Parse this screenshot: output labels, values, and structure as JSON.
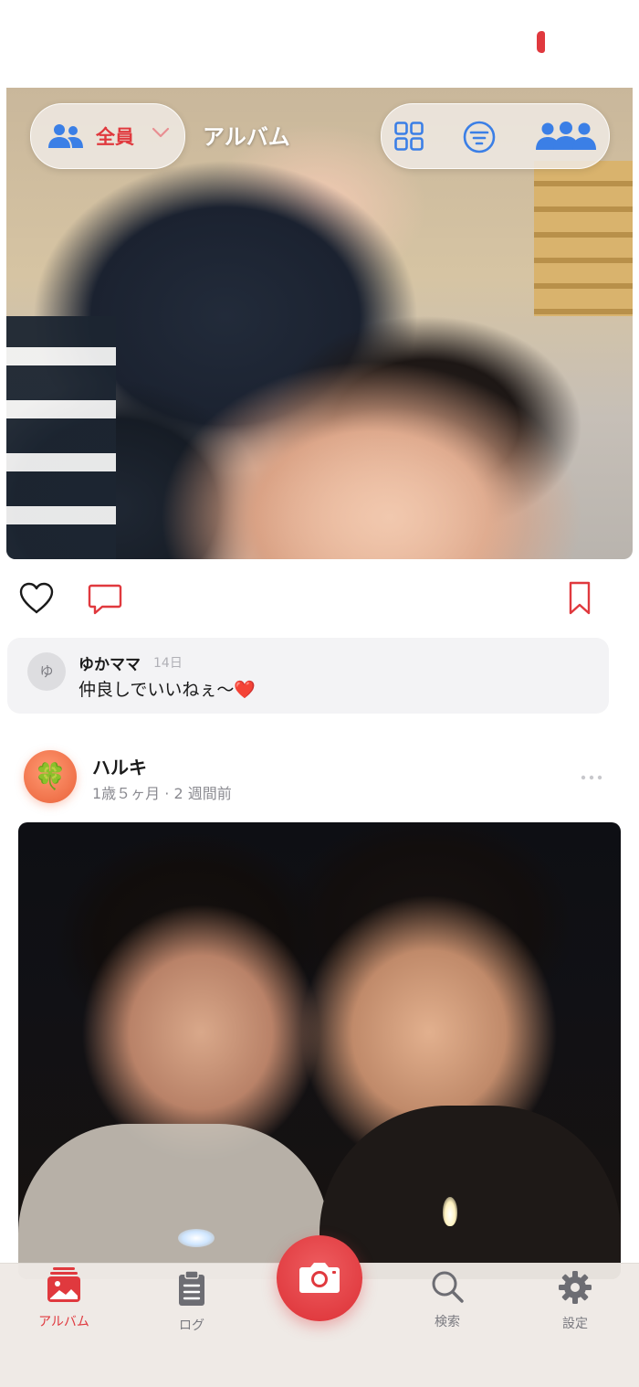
{
  "header": {
    "member_filter_label": "全員",
    "title": "アルバム"
  },
  "icons": {
    "member": "people-icon",
    "dropdown": "chevron-down-icon",
    "grid": "grid-view-icon",
    "filter": "filter-icon",
    "group": "group-icon",
    "like": "heart-icon",
    "comment": "comment-icon",
    "bookmark": "bookmark-icon",
    "more": "more-icon",
    "camera": "camera-icon",
    "album": "album-icon",
    "log": "clipboard-icon",
    "search": "search-icon",
    "settings": "gear-icon"
  },
  "comment": {
    "avatar_initial": "ゆ",
    "author": "ゆかママ",
    "time": "14日",
    "text": "仲良しでいいねぇ〜❤️"
  },
  "post": {
    "avatar_emoji": "🍀",
    "name": "ハルキ",
    "meta": "1歳５ヶ月 · 2 週間前"
  },
  "tabbar": {
    "album": "アルバム",
    "log": "ログ",
    "search": "検索",
    "settings": "設定"
  },
  "colors": {
    "accent": "#e0393e",
    "blue": "#3b7fe6",
    "secondary_text": "#8a8a90"
  }
}
